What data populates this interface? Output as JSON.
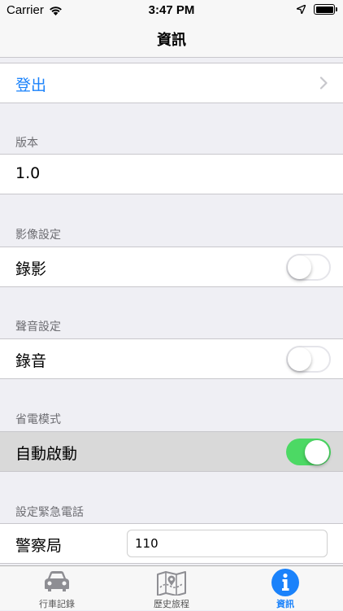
{
  "status_bar": {
    "carrier": "Carrier",
    "time": "3:47 PM"
  },
  "nav": {
    "title": "資訊"
  },
  "logout": {
    "label": "登出"
  },
  "sections": {
    "version": {
      "header": "版本",
      "value": "1.0"
    },
    "video": {
      "header": "影像設定",
      "row_label": "錄影",
      "enabled": false
    },
    "audio": {
      "header": "聲音設定",
      "row_label": "錄音",
      "enabled": false
    },
    "power_saving": {
      "header": "省電模式",
      "row_label": "自動啟動",
      "enabled": true
    },
    "emergency": {
      "header": "設定緊急電話",
      "row_label": "警察局",
      "value": "110"
    }
  },
  "tabs": [
    {
      "label": "行車記錄",
      "icon": "car-icon",
      "active": false
    },
    {
      "label": "歷史旅程",
      "icon": "map-icon",
      "active": false
    },
    {
      "label": "資訊",
      "icon": "info-icon",
      "active": true
    }
  ],
  "colors": {
    "accent": "#1a82fb",
    "switch_on": "#4cd964",
    "background": "#efeff4",
    "tab_inactive": "#8e8e93"
  }
}
